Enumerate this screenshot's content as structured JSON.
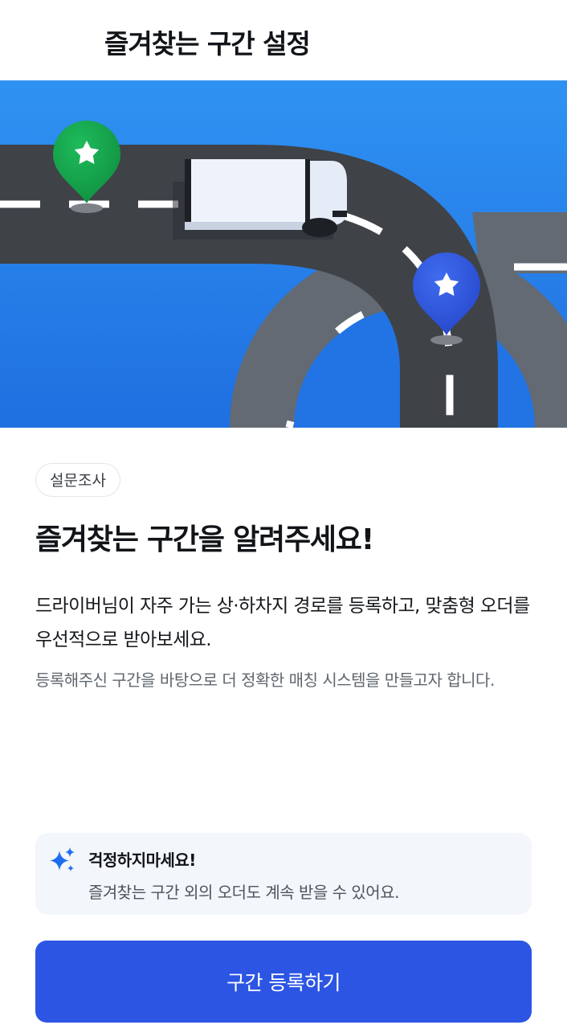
{
  "header": {
    "title": "즐겨찾는 구간 설정"
  },
  "hero": {
    "illustration": "truck-on-road",
    "start_pin_icon": "star-icon",
    "end_pin_icon": "star-icon",
    "sky_color": "#2d8ef0",
    "start_pin_color": "#14a24a",
    "end_pin_color": "#2f57e0"
  },
  "survey": {
    "tag": "설문조사",
    "heading": "즐겨찾는 구간을 알려주세요!",
    "description": "드라이버님이 자주 가는 상·하차지 경로를 등록하고, 맞춤형 오더를 우선적으로 받아보세요.",
    "sub_description": "등록해주신 구간을 바탕으로 더 정확한 매칭 시스템을 만들고자 합니다."
  },
  "notice": {
    "icon": "sparkle-icon",
    "title": "걱정하지마세요!",
    "text": "즐겨찾는 구간 외의 오더도 계속 받을 수 있어요."
  },
  "cta": {
    "label": "구간 등록하기",
    "color": "#2c55e3"
  }
}
